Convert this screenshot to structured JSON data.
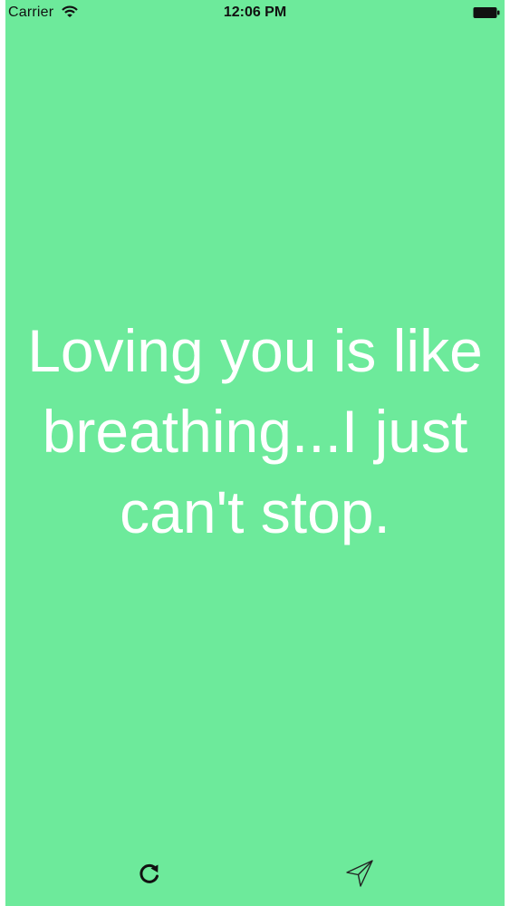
{
  "status_bar": {
    "carrier": "Carrier",
    "time": "12:06 PM",
    "wifi_icon": "wifi-icon",
    "battery_icon": "battery-icon"
  },
  "quote": {
    "text": "Loving you is like breathing...I just can't stop."
  },
  "toolbar": {
    "refresh_icon": "refresh-icon",
    "send_icon": "send-icon"
  },
  "colors": {
    "background": "#6dea9b",
    "quote_text": "#ffffff",
    "status_text": "#111111"
  }
}
